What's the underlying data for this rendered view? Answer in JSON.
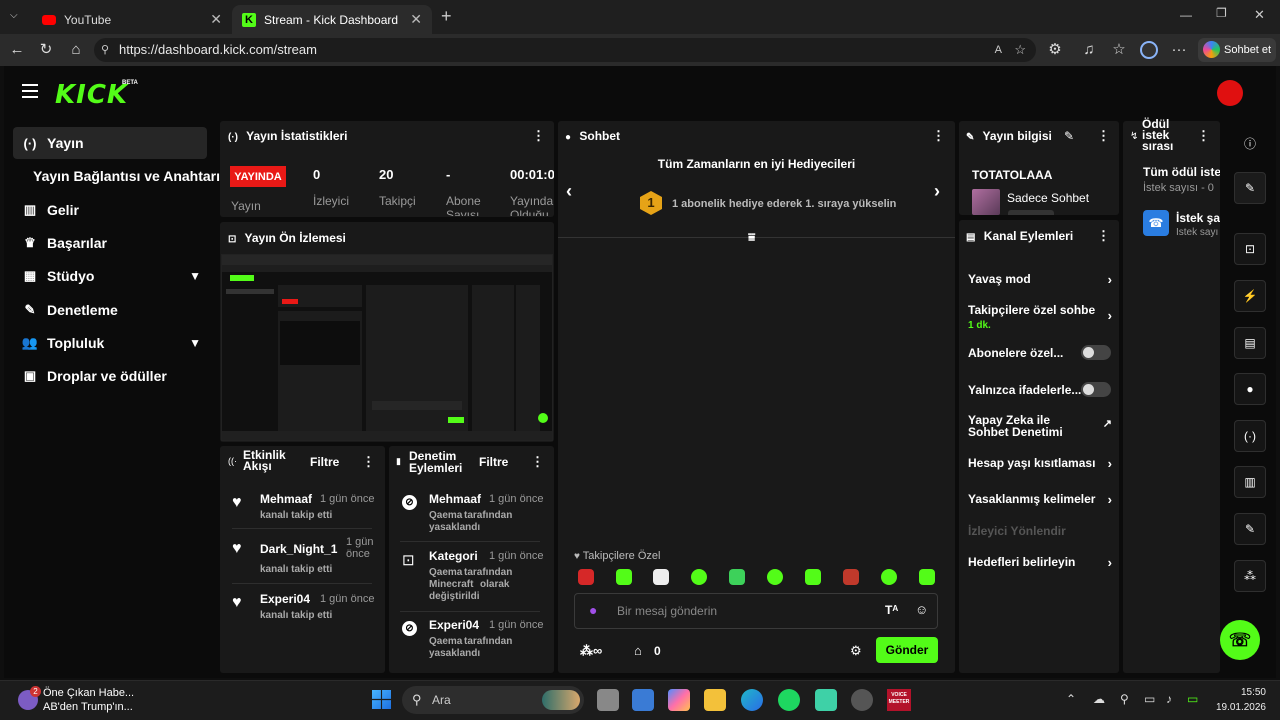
{
  "browser": {
    "tabs": [
      {
        "label": "YouTube",
        "active": false
      },
      {
        "label": "Stream - Kick Dashboard",
        "active": true
      }
    ],
    "url": "https://dashboard.kick.com/stream",
    "sohbet_et": "Sohbet et"
  },
  "app": {
    "logo": "KICK",
    "beta": "BETA",
    "sidebar": [
      {
        "label": "Yayın",
        "icon": "broadcast-icon",
        "active": true
      },
      {
        "label": "Yayın Bağlantısı ve Anahtarı",
        "icon": "",
        "active": false
      },
      {
        "label": "Gelir",
        "icon": "chart-icon",
        "active": false
      },
      {
        "label": "Başarılar",
        "icon": "trophy-icon",
        "active": false
      },
      {
        "label": "Stüdyo",
        "icon": "studio-icon",
        "active": false
      },
      {
        "label": "Denetleme",
        "icon": "wrench-icon",
        "active": false
      },
      {
        "label": "Topluluk",
        "icon": "people-icon",
        "active": false
      },
      {
        "label": "Droplar ve ödüller",
        "icon": "gift-icon",
        "active": false
      }
    ],
    "stats": {
      "title": "Yayın İstatistikleri",
      "live_badge": "YAYINDA",
      "live_label": "Yayın",
      "viewers": "0",
      "viewers_label": "İzleyici",
      "followers": "20",
      "followers_label": "Takipçi",
      "subs": "-",
      "subs_label": "Abone Sayısı",
      "uptime": "00:01:0",
      "uptime_label": "Yayında Olduğu"
    },
    "preview": {
      "title": "Yayın Ön İzlemesi"
    },
    "activity": {
      "title": "Etkinlik Akışı",
      "filter": "Filtre",
      "items": [
        {
          "name": "Mehmaaf",
          "time": "1 gün önce",
          "desc": "kanalı takip etti"
        },
        {
          "name": "Dark_Night_1",
          "time": "1 gün önce",
          "desc": "kanalı takip etti"
        },
        {
          "name": "Experi04",
          "time": "1 gün önce",
          "desc": "kanalı takip etti"
        }
      ]
    },
    "moderation": {
      "title": "Denetim Eylemleri",
      "filter": "Filtre",
      "items": [
        {
          "name": "Mehmaaf",
          "time": "1 gün önce",
          "by": "Qaema",
          "rest": "tarafından",
          "line2": "yasaklandı"
        },
        {
          "name": "Kategori",
          "time": "1 gün önce",
          "by": "Qaema",
          "rest": "tarafından",
          "cat": "Minecraft",
          "cat_rest": "olarak",
          "line3": "değiştirildi"
        },
        {
          "name": "Experi04",
          "time": "1 gün önce",
          "by": "Qaema",
          "rest": "tarafından",
          "line2": "yasaklandı"
        }
      ]
    },
    "chat": {
      "title": "Sohbet",
      "top_gifters": "Tüm Zamanların en iyi Hediyecileri",
      "rank": "1",
      "gift_hint": "1 abonelik hediye ederek 1. sıraya yükselin",
      "followers_only": "Takipçilere Özel",
      "placeholder": "Bir mesaj gönderin",
      "points": "0",
      "send": "Gönder"
    },
    "stream_info": {
      "title": "Yayın bilgisi",
      "channel": "TOTATOLAAA",
      "category": "Sadece Sohbet"
    },
    "channel_actions": {
      "title": "Kanal Eylemleri",
      "items": [
        {
          "label": "Yavaş mod",
          "type": "arrow"
        },
        {
          "label": "Takipçilere özel sohbe",
          "sub": "1 dk.",
          "type": "arrow"
        },
        {
          "label": "Abonelere özel...",
          "type": "toggle"
        },
        {
          "label": "Yalnızca ifadelerle...",
          "type": "toggle"
        },
        {
          "label": "Yapay Zeka ile Sohbet Denetimi",
          "type": "external"
        },
        {
          "label": "Hesap yaşı kısıtlaması",
          "type": "arrow"
        },
        {
          "label": "Yasaklanmış kelimeler",
          "type": "arrow"
        },
        {
          "label": "İzleyici Yönlendir",
          "type": "disabled"
        },
        {
          "label": "Hedefleri belirleyin",
          "type": "arrow"
        }
      ]
    },
    "rewards": {
      "title": "Ödül istek sırası",
      "all_requests": "Tüm ödül istek",
      "count": "İstek sayısı - 0",
      "item_title": "İstek şa",
      "item_sub": "İstek sayı"
    }
  },
  "taskbar": {
    "news_title": "Öne Çıkan Habe...",
    "news_sub": "AB'den Trump'ın...",
    "news_badge": "2",
    "search": "Ara",
    "time": "15:50",
    "date": "19.01.2026",
    "voicemeeter": "VOICE MEETER"
  },
  "colors": {
    "accent": "#53fc18",
    "live": "#e91916",
    "panel": "#191919"
  }
}
